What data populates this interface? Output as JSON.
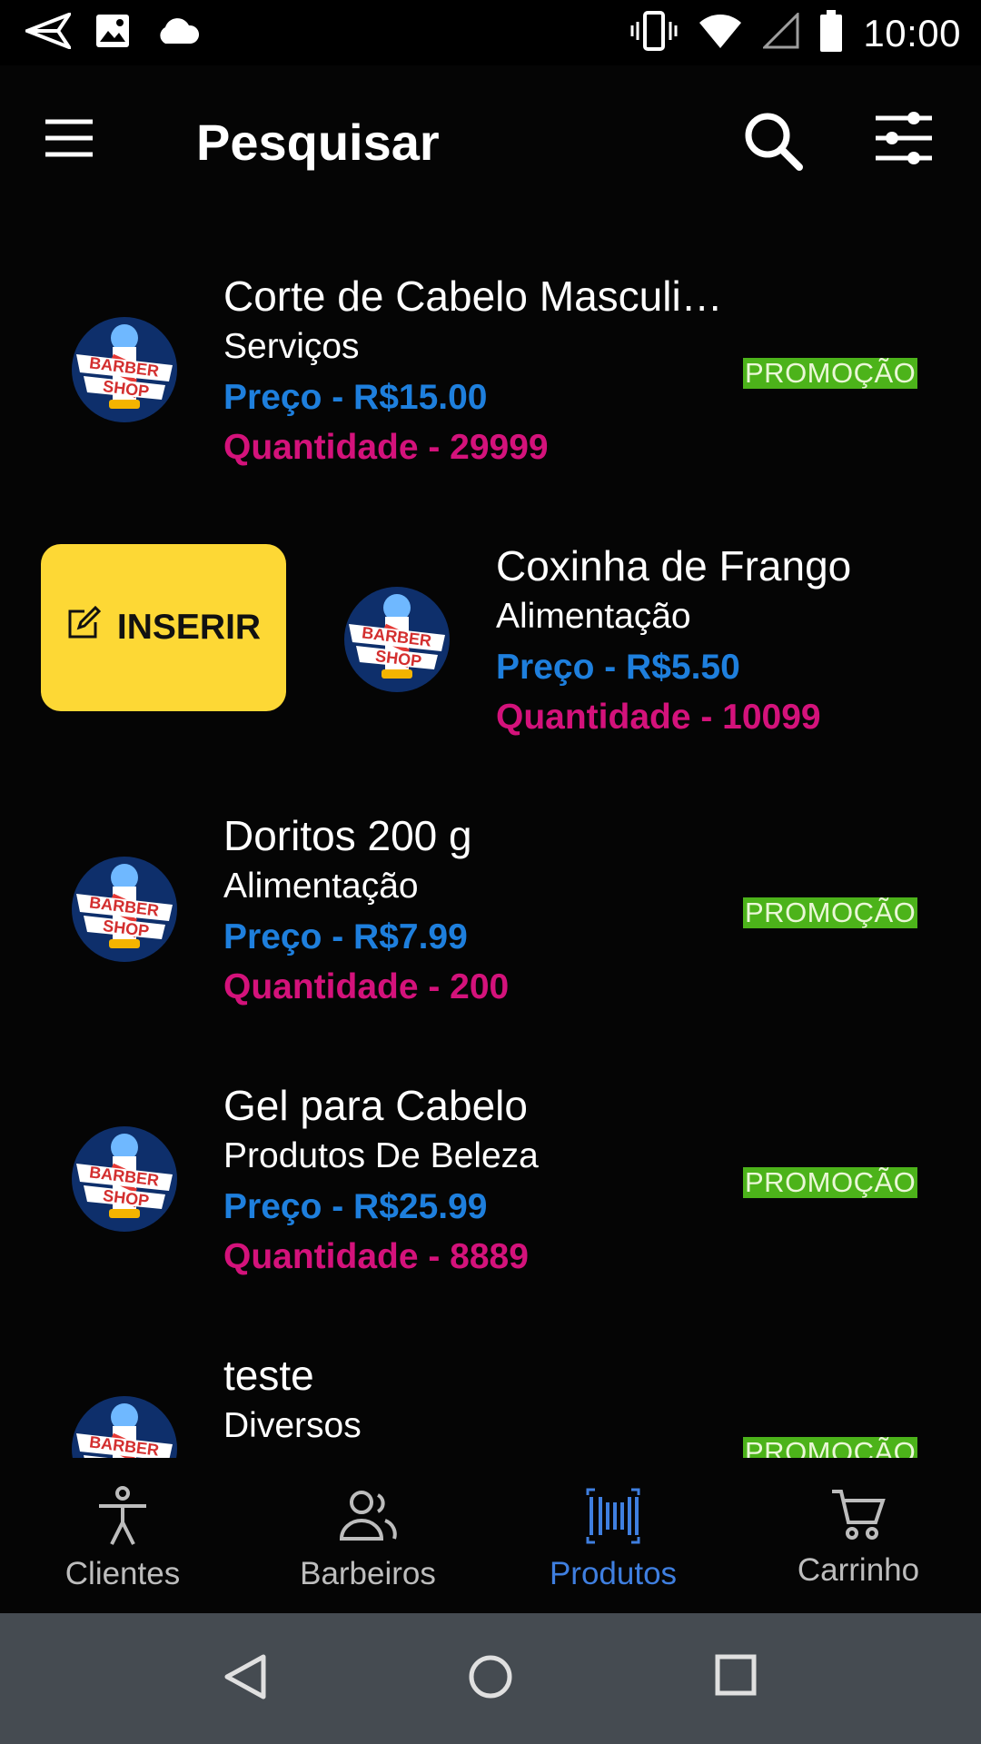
{
  "status_bar": {
    "time": "10:00"
  },
  "app_bar": {
    "title": "Pesquisar"
  },
  "swipe_action": {
    "label": "INSERIR"
  },
  "products": [
    {
      "name": "Corte de Cabelo Masculi…",
      "category": "Serviços",
      "price": "Preço - R$15.00",
      "quantity": "Quantidade - 29999",
      "badge": "PROMOÇÃO"
    },
    {
      "name": "Coxinha de Frango",
      "category": "Alimentação",
      "price": "Preço - R$5.50",
      "quantity": "Quantidade - 10099",
      "badge": ""
    },
    {
      "name": "Doritos 200 g",
      "category": "Alimentação",
      "price": "Preço - R$7.99",
      "quantity": "Quantidade - 200",
      "badge": "PROMOÇÃO"
    },
    {
      "name": "Gel para Cabelo",
      "category": "Produtos De Beleza",
      "price": "Preço - R$25.99",
      "quantity": "Quantidade - 8889",
      "badge": "PROMOÇÃO"
    },
    {
      "name": "teste",
      "category": "Diversos",
      "price": "",
      "quantity": "",
      "badge": "PROMOÇÃO"
    }
  ],
  "avatar_logo": {
    "line1": "BARBER",
    "line2": "SHOP"
  },
  "bottom_nav": [
    {
      "label": "Clientes",
      "icon": "person-icon"
    },
    {
      "label": "Barbeiros",
      "icon": "people-icon"
    },
    {
      "label": "Produtos",
      "icon": "barcode-icon",
      "active": true
    },
    {
      "label": "Carrinho",
      "icon": "cart-icon"
    }
  ],
  "colors": {
    "price": "#1e7fdd",
    "quantity": "#d4127b",
    "promo": "#4cb31a",
    "insert": "#fdd835",
    "active_nav": "#3f7fe0"
  }
}
